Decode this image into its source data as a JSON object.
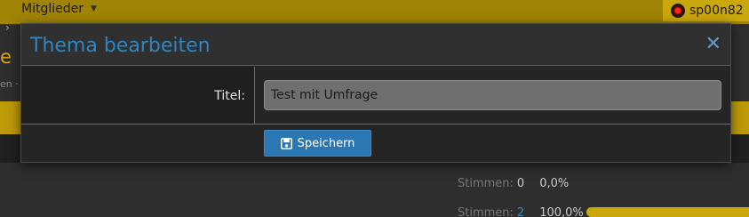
{
  "topbar": {
    "nav_label": "Mitglieder",
    "nav_caret": "▼",
    "username": "sp00n82",
    "bg_color": "#a08406"
  },
  "background": {
    "crumb_glyph": "›",
    "title_fragment": "e",
    "subtitle_fragment": "en ·",
    "poll_rows": [
      {
        "label": "Stimmen:",
        "count": "0",
        "percent": "0,0%"
      },
      {
        "label": "Stimmen:",
        "count": "2",
        "percent": "100,0%"
      }
    ]
  },
  "modal": {
    "title": "Thema bearbeiten",
    "close_glyph": "✕",
    "title_label": "Titel:",
    "title_value": "Test mit Umfrage",
    "save_label": "Speichern",
    "save_icon": "floppy-disk-icon",
    "accent_color": "#2d86c4",
    "button_color": "#2a77b3"
  }
}
